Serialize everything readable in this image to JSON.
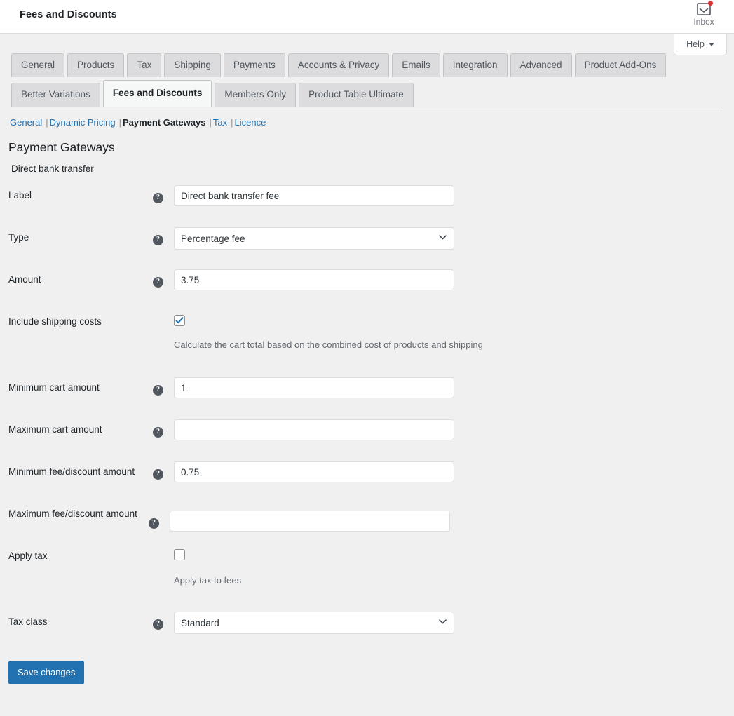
{
  "header": {
    "title": "Fees and Discounts",
    "inbox_label": "Inbox",
    "inbox_icon": "inbox-tray-icon",
    "has_notification": true,
    "help_label": "Help",
    "help_caret_icon": "chevron-down-icon"
  },
  "tabs": {
    "row1": [
      {
        "label": "General",
        "active": false
      },
      {
        "label": "Products",
        "active": false
      },
      {
        "label": "Tax",
        "active": false
      },
      {
        "label": "Shipping",
        "active": false
      },
      {
        "label": "Payments",
        "active": false
      },
      {
        "label": "Accounts & Privacy",
        "active": false
      },
      {
        "label": "Emails",
        "active": false
      },
      {
        "label": "Integration",
        "active": false
      },
      {
        "label": "Advanced",
        "active": false
      },
      {
        "label": "Product Add-Ons",
        "active": false
      }
    ],
    "row2": [
      {
        "label": "Better Variations",
        "active": false
      },
      {
        "label": "Fees and Discounts",
        "active": true
      },
      {
        "label": "Members Only",
        "active": false
      },
      {
        "label": "Product Table Ultimate",
        "active": false
      }
    ]
  },
  "subnav": {
    "items": [
      {
        "label": "General",
        "current": false
      },
      {
        "label": "Dynamic Pricing",
        "current": false
      },
      {
        "label": "Payment Gateways",
        "current": true
      },
      {
        "label": "Tax",
        "current": false
      },
      {
        "label": "Licence",
        "current": false
      }
    ],
    "separator": "|"
  },
  "page": {
    "heading": "Payment Gateways",
    "section_subtitle": "Direct bank transfer"
  },
  "form": {
    "help_glyph": "?",
    "fields": {
      "label": {
        "label": "Label",
        "value": "Direct bank transfer fee"
      },
      "type": {
        "label": "Type",
        "value": "Percentage fee"
      },
      "amount": {
        "label": "Amount",
        "value": "3.75"
      },
      "include_shipping": {
        "label": "Include shipping costs",
        "checked": true,
        "description": "Calculate the cart total based on the combined cost of products and shipping"
      },
      "min_cart": {
        "label": "Minimum cart amount",
        "value": "1"
      },
      "max_cart": {
        "label": "Maximum cart amount",
        "value": ""
      },
      "min_fee": {
        "label": "Minimum fee/discount amount",
        "value": "0.75"
      },
      "max_fee": {
        "label": "Maximum fee/discount amount",
        "value": ""
      },
      "apply_tax": {
        "label": "Apply tax",
        "checked": false,
        "description": "Apply tax to fees"
      },
      "tax_class": {
        "label": "Tax class",
        "value": "Standard"
      }
    },
    "save_label": "Save changes"
  },
  "colors": {
    "accent_blue": "#2271b1",
    "page_bg": "#f0f0f1",
    "notification_red": "#d63638",
    "tab_inactive_bg": "#dcdcde"
  }
}
